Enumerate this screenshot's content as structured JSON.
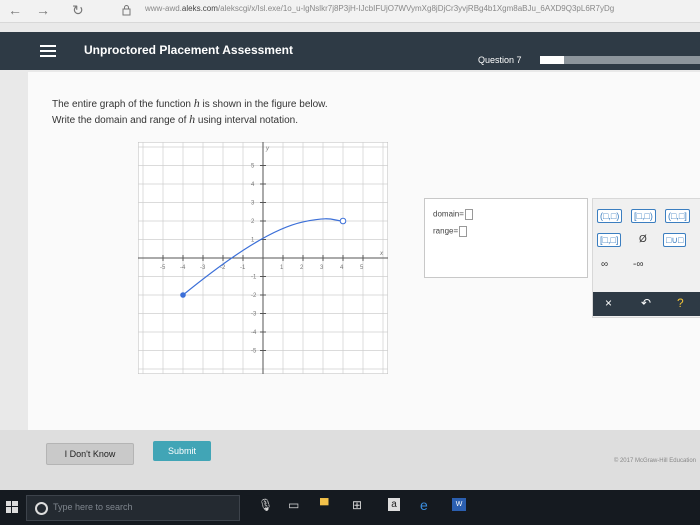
{
  "browser": {
    "url_domain": "aleks.com",
    "url_prefix": "www-awd.",
    "url_rest": "/alekscgi/x/Isl.exe/1o_u-lgNslkr7j8P3jH-IJcbIFUjO7WVymXg8jDjCr3yvjRBg4b1Xgm8aBJu_6AXD9Q3pL6R7yDg"
  },
  "header": {
    "title": "Unproctored Placement Assessment",
    "question_label": "Question 7",
    "progress_fraction": 0.15
  },
  "question": {
    "line1_prefix": "The entire graph of the function ",
    "func": "h",
    "line1_suffix": " is shown in the figure below.",
    "line2_prefix": "Write the domain and range of ",
    "line2_suffix": " using interval notation."
  },
  "graph": {
    "axis_y_label": "y",
    "axis_x_label": "x",
    "x_ticks": [
      "-5",
      "-4",
      "-3",
      "-2",
      "-1",
      "1",
      "2",
      "3",
      "4",
      "5"
    ],
    "y_ticks": [
      "5",
      "4",
      "3",
      "2",
      "1",
      "-1",
      "-2",
      "-3",
      "-4",
      "-5"
    ],
    "curve": {
      "start": [
        -4,
        -2
      ],
      "start_closed": true,
      "end": [
        4,
        2
      ],
      "end_closed": false
    }
  },
  "answer": {
    "domain_label": "domain=",
    "range_label": "range="
  },
  "tools": {
    "open_open": "(□,□)",
    "closed_open": "[□,□)",
    "open_closed": "(□,□]",
    "closed_closed": "[□,□]",
    "empty_set": "Ø",
    "union": "□∪□",
    "infinity": "∞",
    "neg_infinity": "-∞",
    "clear": "×",
    "undo": "↶",
    "help": "?"
  },
  "footer": {
    "dont_know": "I Don't Know",
    "submit": "Submit",
    "copyright": "© 2017 McGraw-Hill Education"
  },
  "taskbar": {
    "search_placeholder": "Type here to search"
  }
}
